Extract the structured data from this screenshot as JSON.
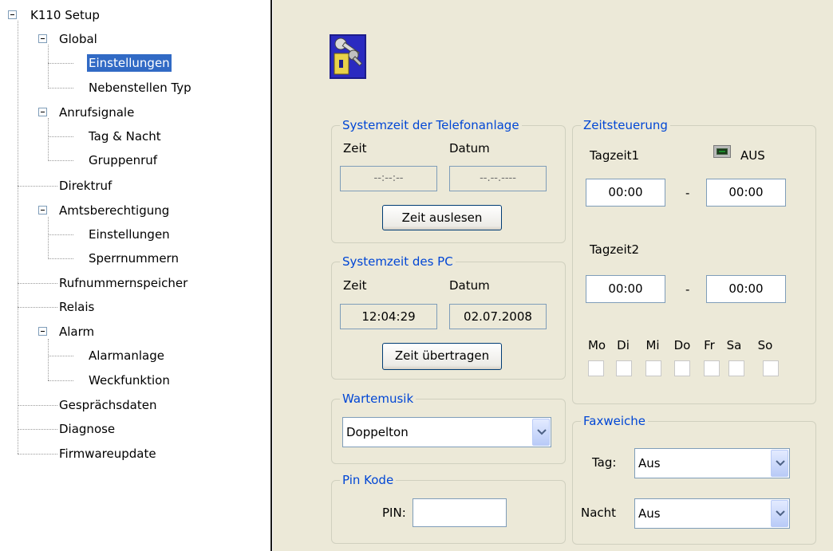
{
  "tree": {
    "root": "K110 Setup",
    "global": "Global",
    "global_einstellungen": "Einstellungen",
    "global_nebenstellen": "Nebenstellen Typ",
    "anrufsignale": "Anrufsignale",
    "tag_nacht": "Tag & Nacht",
    "gruppenruf": "Gruppenruf",
    "direktruf": "Direktruf",
    "amtsberechtigung": "Amtsberechtigung",
    "amts_einstellungen": "Einstellungen",
    "sperrnummern": "Sperrnummern",
    "rufnummernspeicher": "Rufnummernspeicher",
    "relais": "Relais",
    "alarm": "Alarm",
    "alarmanlage": "Alarmanlage",
    "weckfunktion": "Weckfunktion",
    "gespraechsdaten": "Gesprächsdaten",
    "diagnose": "Diagnose",
    "firmwareupdate": "Firmwareupdate"
  },
  "header_icon": "keys-lock-icon",
  "systemzeit_anlage": {
    "legend": "Systemzeit der Telefonanlage",
    "zeit_label": "Zeit",
    "datum_label": "Datum",
    "zeit_value": "--:--:--",
    "datum_value": "--.--.----",
    "button": "Zeit auslesen"
  },
  "systemzeit_pc": {
    "legend": "Systemzeit des PC",
    "zeit_label": "Zeit",
    "datum_label": "Datum",
    "zeit_value": "12:04:29",
    "datum_value": "02.07.2008",
    "button": "Zeit übertragen"
  },
  "wartemusik": {
    "legend": "Wartemusik",
    "selected": "Doppelton"
  },
  "pin": {
    "legend": "Pin Kode",
    "label": "PIN:",
    "value": ""
  },
  "zeitsteuerung": {
    "legend": "Zeitsteuerung",
    "tagzeit1_label": "Tagzeit1",
    "status_label": "AUS",
    "status_color": "#1a8a2a",
    "t1_from": "00:00",
    "t1_to": "00:00",
    "tagzeit2_label": "Tagzeit2",
    "t2_from": "00:00",
    "t2_to": "00:00",
    "dash": "-",
    "days": [
      "Mo",
      "Di",
      "Mi",
      "Do",
      "Fr",
      "Sa",
      "So"
    ]
  },
  "faxweiche": {
    "legend": "Faxweiche",
    "tag_label": "Tag:",
    "tag_value": "Aus",
    "nacht_label": "Nacht",
    "nacht_value": "Aus"
  },
  "colors": {
    "selection": "#316ac5",
    "legend_text": "#0046d5",
    "panel_bg": "#ece9d8"
  }
}
